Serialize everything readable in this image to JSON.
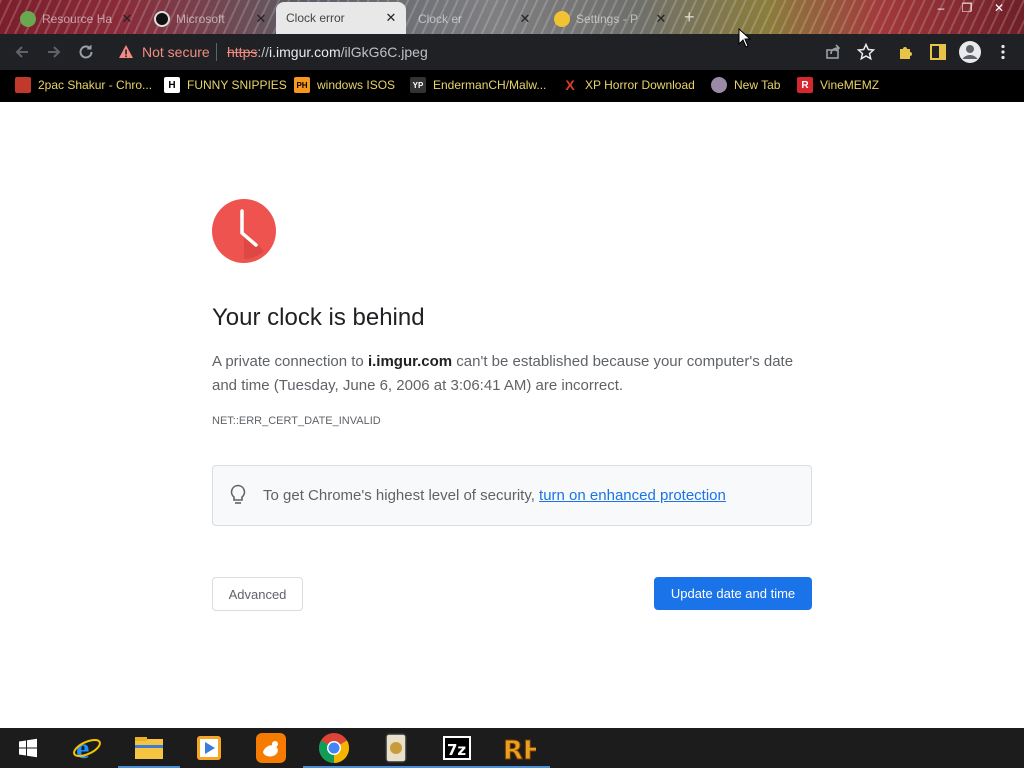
{
  "tabs": [
    {
      "title": "Resource Ha",
      "active": false
    },
    {
      "title": "Microsoft",
      "active": false
    },
    {
      "title": "Clock error",
      "active": true
    },
    {
      "title": "Clock er",
      "active": false
    },
    {
      "title": "Settings - P",
      "active": false
    }
  ],
  "window_controls": {
    "minimize": "–",
    "restore": "❐",
    "close": "✕"
  },
  "toolbar": {
    "security_label": "Not secure",
    "url_scheme": "https",
    "url_sep": "://",
    "url_host": "i.imgur.com",
    "url_path": "/ilGkG6C.jpeg"
  },
  "bookmarks": [
    {
      "label": "2pac Shakur - Chro...",
      "icon_text": "",
      "icon_color": "#c0392b"
    },
    {
      "label": "FUNNY SNIPPIES",
      "icon_text": "H",
      "icon_color": "#ffffff"
    },
    {
      "label": "windows ISOS",
      "icon_text": "PH",
      "icon_color": "#f7971d"
    },
    {
      "label": "EndermanCH/Malw...",
      "icon_text": "YP",
      "icon_color": "#333333"
    },
    {
      "label": "XP Horror Download",
      "icon_text": "X",
      "icon_color": "#e23b2e"
    },
    {
      "label": "New Tab",
      "icon_text": "",
      "icon_color": "#9b8aa5"
    },
    {
      "label": "VineMEMZ",
      "icon_text": "R",
      "icon_color": "#d6272e"
    }
  ],
  "content": {
    "heading": "Your clock is behind",
    "desc_pre": "A private connection to ",
    "desc_host": "i.imgur.com",
    "desc_post": " can't be established because your computer's date and time (Tuesday, June 6, 2006 at 3:06:41 AM) are incorrect.",
    "error_code": "NET::ERR_CERT_DATE_INVALID",
    "security_text": "To get Chrome's highest level of security, ",
    "security_link": "turn on enhanced protection",
    "advanced_label": "Advanced",
    "update_label": "Update date and time"
  },
  "colors": {
    "accent_blue": "#1a73e8",
    "clock_red": "#ee5350",
    "not_secure_red": "#f28b82",
    "bookmark_text": "#e8d46a"
  },
  "taskbar": {
    "apps": [
      "start-icon",
      "internet-explorer-icon",
      "file-explorer-icon",
      "media-player-icon",
      "uc-browser-icon",
      "chrome-icon",
      "bandicam-icon",
      "7zip-icon",
      "resource-hacker-icon"
    ]
  }
}
